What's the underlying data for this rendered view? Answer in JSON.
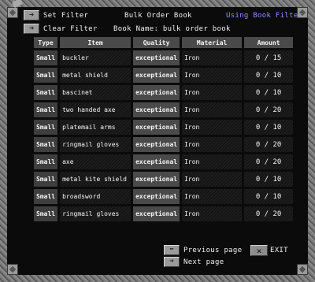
{
  "header": {
    "set_filter": "Set Filter",
    "clear_filter": "Clear Filter",
    "title": "Bulk Order Book",
    "book_name": "Book Name: bulk order book",
    "using_filter": "Using Book Filter"
  },
  "columns": [
    "Type",
    "Item",
    "Quality",
    "Material",
    "Amount"
  ],
  "rows": [
    {
      "type": "Small",
      "item": "buckler",
      "quality": "exceptional",
      "material": "Iron",
      "amount": "0 / 15"
    },
    {
      "type": "Small",
      "item": "metal shield",
      "quality": "exceptional",
      "material": "Iron",
      "amount": "0 / 10"
    },
    {
      "type": "Small",
      "item": "bascinet",
      "quality": "exceptional",
      "material": "Iron",
      "amount": "0 / 10"
    },
    {
      "type": "Small",
      "item": "two handed axe",
      "quality": "exceptional",
      "material": "Iron",
      "amount": "0 / 20"
    },
    {
      "type": "Small",
      "item": "platemail arms",
      "quality": "exceptional",
      "material": "Iron",
      "amount": "0 / 10"
    },
    {
      "type": "Small",
      "item": "ringmail gloves",
      "quality": "exceptional",
      "material": "Iron",
      "amount": "0 / 20"
    },
    {
      "type": "Small",
      "item": "axe",
      "quality": "exceptional",
      "material": "Iron",
      "amount": "0 / 20"
    },
    {
      "type": "Small",
      "item": "metal kite shield",
      "quality": "exceptional",
      "material": "Iron",
      "amount": "0 / 10"
    },
    {
      "type": "Small",
      "item": "broadsword",
      "quality": "exceptional",
      "material": "Iron",
      "amount": "0 / 10"
    },
    {
      "type": "Small",
      "item": "ringmail gloves",
      "quality": "exceptional",
      "material": "Iron",
      "amount": "0 / 20"
    }
  ],
  "footer": {
    "previous_page": "Previous page",
    "next_page": "Next page",
    "exit": "EXIT"
  }
}
